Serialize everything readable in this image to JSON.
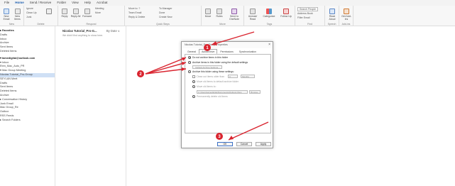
{
  "menu": [
    "File",
    "Home",
    "Send / Receive",
    "Folder",
    "View",
    "Help",
    "Acrobat"
  ],
  "ribbon": {
    "new_email": "New Email",
    "new_items": "New Items",
    "new_group": "New",
    "delete_small": [
      "Ignore",
      "Clean Up",
      "Junk"
    ],
    "delete_group": "Delete",
    "reply": "Reply",
    "reply_all": "Reply All",
    "forward": "Forward",
    "more_small": [
      "Meeting",
      "More"
    ],
    "respond_group": "Respond",
    "quicksteps": [
      "Move to: ?",
      "Team Email",
      "Reply & Delete"
    ],
    "quicksteps_right": [
      "To Manager",
      "Done",
      "Create New"
    ],
    "quicksteps_group": "Quick Steps",
    "move": "Move",
    "rules": "Rules",
    "send_onenote": "Send to OneNote",
    "move_group": "Move",
    "unread_read": "Unread/ Read",
    "categorize": "Categorize",
    "follow_up": "Follow Up",
    "tags_group": "Tags",
    "search_people": "Search People",
    "address_book": "Address Book",
    "filter_email": "Filter Email",
    "find_group": "Find",
    "read_aloud": "Read Aloud",
    "speech_group": "Speech",
    "get_addins": "Get Add-ins",
    "addins_group": "Add-ins"
  },
  "nav": {
    "items": [
      {
        "label": "▸ Favorites",
        "type": "hdr"
      },
      {
        "label": "   Drafts",
        "type": ""
      },
      {
        "label": "   Inbox",
        "type": ""
      },
      {
        "label": "   Archive",
        "type": ""
      },
      {
        "label": "   Sent Items",
        "type": ""
      },
      {
        "label": "   Deleted Items",
        "type": ""
      },
      {
        "label": "",
        "type": ""
      },
      {
        "label": "▾ tamedigitai@outlook.com",
        "type": "hdr"
      },
      {
        "label": " ▾ Inbox",
        "type": ""
      },
      {
        "label": "     Eten_Mac_Auto_PR",
        "type": ""
      },
      {
        "label": "   ▾ Mac Group Meeting",
        "type": ""
      },
      {
        "label": "       Nicolas Tutorial_Pro-Group",
        "type": "sel"
      },
      {
        "label": "       SEYLAN Meet",
        "type": ""
      },
      {
        "label": "   Drafts",
        "type": ""
      },
      {
        "label": "   Sent Items",
        "type": ""
      },
      {
        "label": "   Deleted Items",
        "type": ""
      },
      {
        "label": "   Archive",
        "type": ""
      },
      {
        "label": " ▸ Conversation History",
        "type": ""
      },
      {
        "label": "   Junk Email",
        "type": ""
      },
      {
        "label": "   Mac Group_Re",
        "type": ""
      },
      {
        "label": "   Outbox",
        "type": ""
      },
      {
        "label": "   RSS Feeds",
        "type": ""
      },
      {
        "label": " ▸ Search Folders",
        "type": ""
      }
    ]
  },
  "message_list": {
    "folder": "Nicolas Tutorial_Pro-G...",
    "sort": "By Date ∨",
    "empty": "We didn't find anything to show here."
  },
  "dialog": {
    "title": "Nicolas Tutorial_Pro-Group Properties",
    "close": "×",
    "tabs": [
      "General",
      "AutoArchive",
      "Permissions",
      "Synchronization"
    ],
    "active_tab": "AutoArchive",
    "opt1": "Do not archive items in this folder",
    "opt2": "Archive items in this folder using the default settings",
    "default_btn": "Default Archive Settings...",
    "opt3": "Archive this folder using these settings:",
    "clean_label": "Clean out items older than",
    "clean_value": "3",
    "clean_unit": "Months",
    "move_default": "Move old items to default archive folder",
    "move_to": "Move old items to:",
    "path": "C:\\Users\\tamedigitai\\Documents\\Outlook Files",
    "browse": "Browse...",
    "perm_delete": "Permanently delete old items",
    "ok": "OK",
    "cancel": "Cancel",
    "apply": "Apply"
  },
  "annotations": {
    "badge1": "1",
    "badge2": "2",
    "badge3": "3",
    "color": "#d9232e"
  }
}
